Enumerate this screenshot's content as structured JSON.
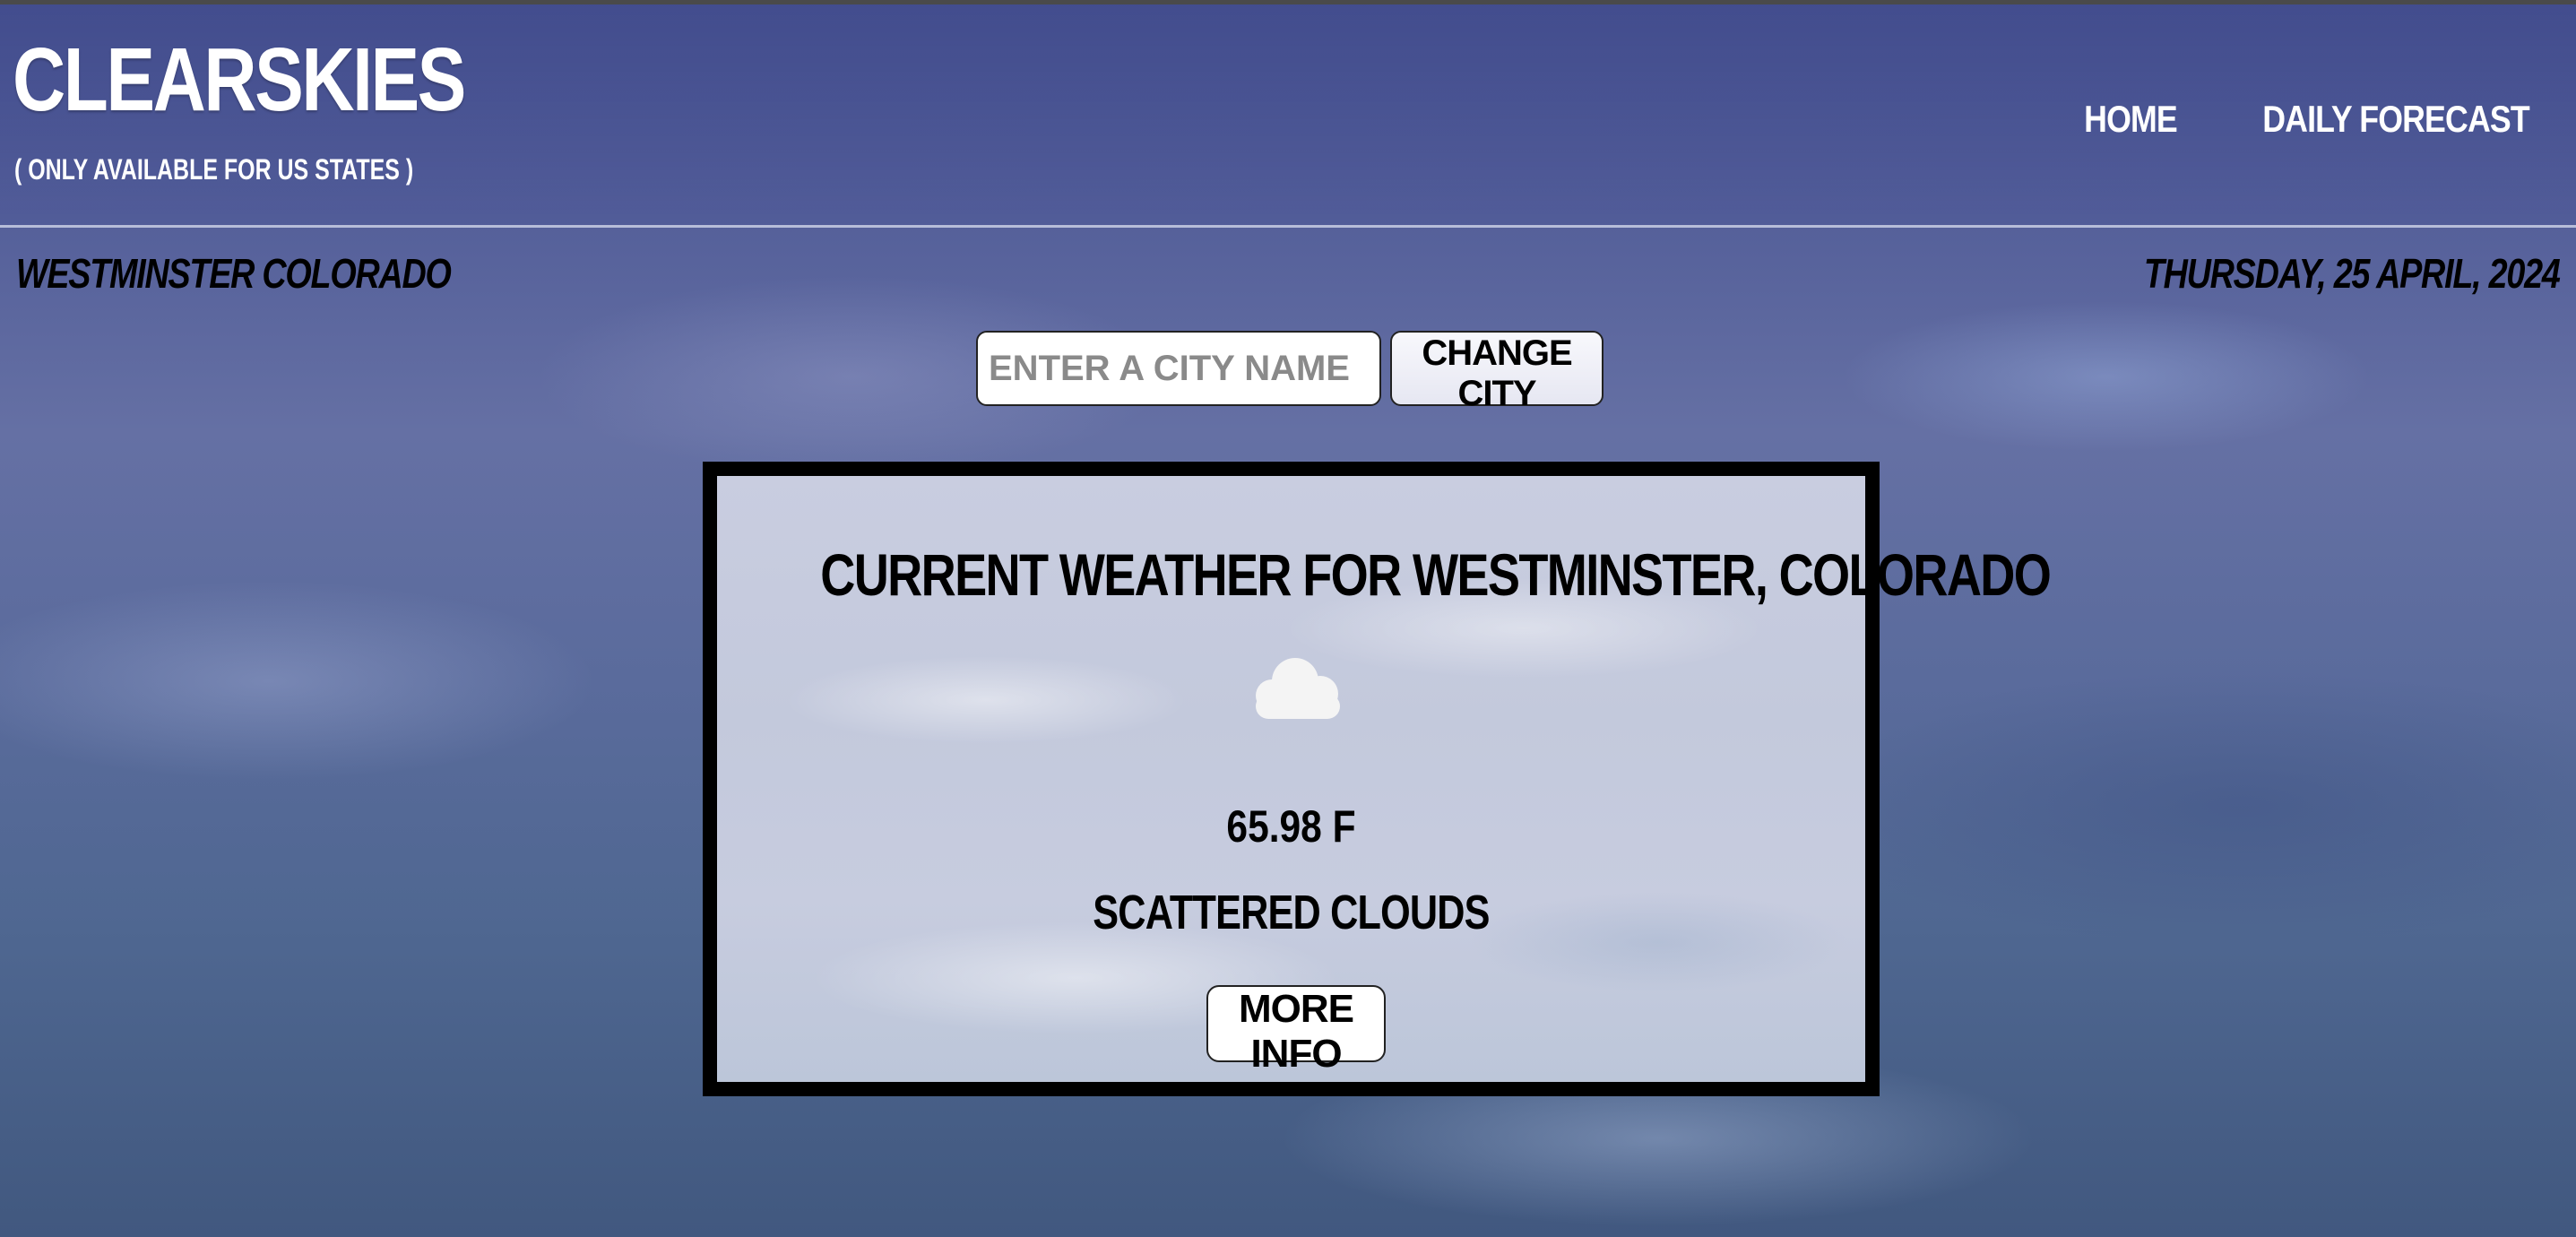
{
  "header": {
    "title": "CLEARSKIES",
    "subtitle": "( ONLY AVAILABLE FOR US STATES )",
    "nav": [
      {
        "label": "HOME"
      },
      {
        "label": "DAILY FORECAST"
      }
    ]
  },
  "info_bar": {
    "location": "WESTMINSTER COLORADO",
    "date": "THURSDAY, 25 APRIL, 2024"
  },
  "search": {
    "placeholder": "ENTER A CITY NAME",
    "value": "",
    "button_label": "CHANGE CITY"
  },
  "weather_card": {
    "title": "CURRENT WEATHER FOR WESTMINSTER, COLORADO",
    "icon": "cloud-icon",
    "temperature": "65.98 F",
    "description": "SCATTERED CLOUDS",
    "more_button_label": "MORE INFO"
  },
  "colors": {
    "header_text": "#ffffff",
    "body_text": "#000000",
    "card_border": "#000000",
    "icon": "#f4f4f4"
  }
}
